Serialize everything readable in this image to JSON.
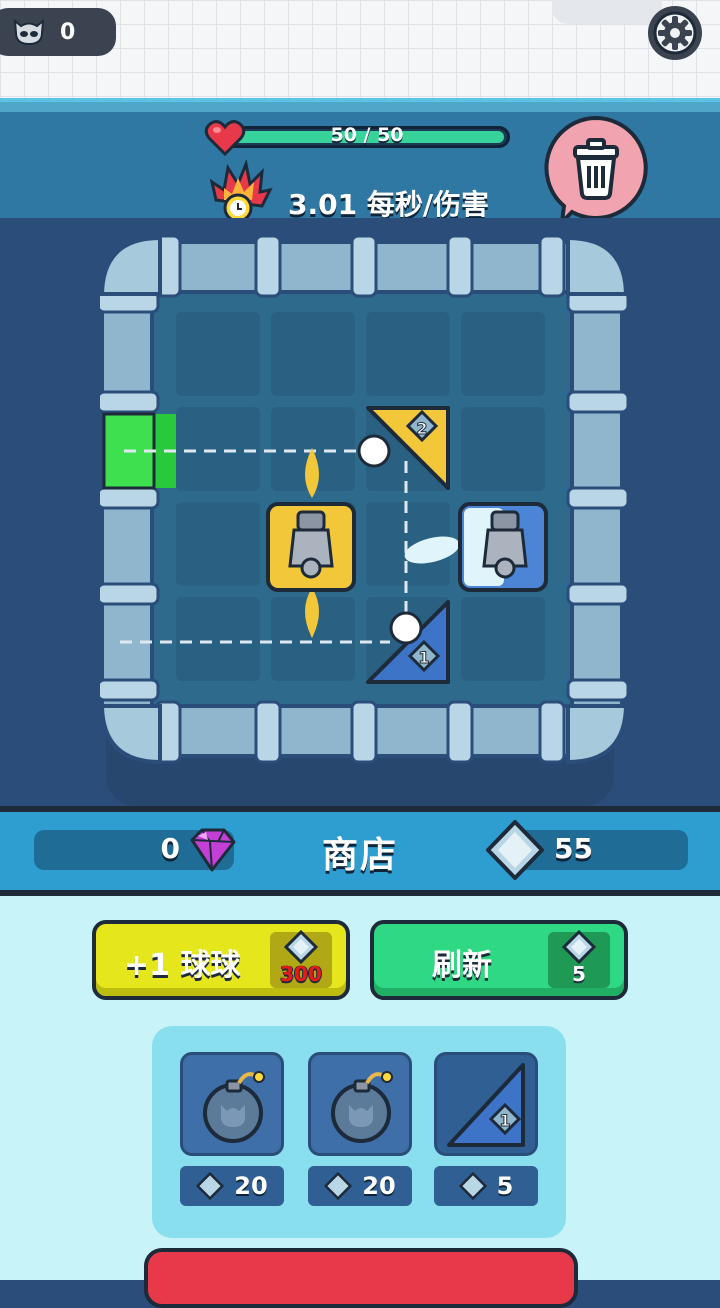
{
  "top": {
    "skull_count": "0"
  },
  "hud": {
    "hp_text": "50 / 50",
    "hp_fraction": 1.0,
    "dps_text": "3.01 每秒/伤害"
  },
  "board": {
    "tiles": [
      {
        "name": "triangle-block",
        "level": "2"
      },
      {
        "name": "triangle-block",
        "level": "1"
      }
    ]
  },
  "shop": {
    "title": "商店",
    "gem_count": "0",
    "crystal_count": "55",
    "add_ball_label": "+1 球球",
    "add_ball_cost": "300",
    "refresh_label": "刷新",
    "refresh_cost": "5",
    "items": [
      {
        "icon": "bomb-icon",
        "price": "20"
      },
      {
        "icon": "bomb-icon",
        "price": "20"
      },
      {
        "icon": "triangle-block-icon",
        "level": "1",
        "price": "5"
      }
    ]
  },
  "colors": {
    "accent_green": "#37d39a",
    "yellow_button": "#e6e61c",
    "green_button": "#2fd882",
    "trash_pink": "#f1a4b0",
    "board_bg": "#2a4d7a"
  }
}
